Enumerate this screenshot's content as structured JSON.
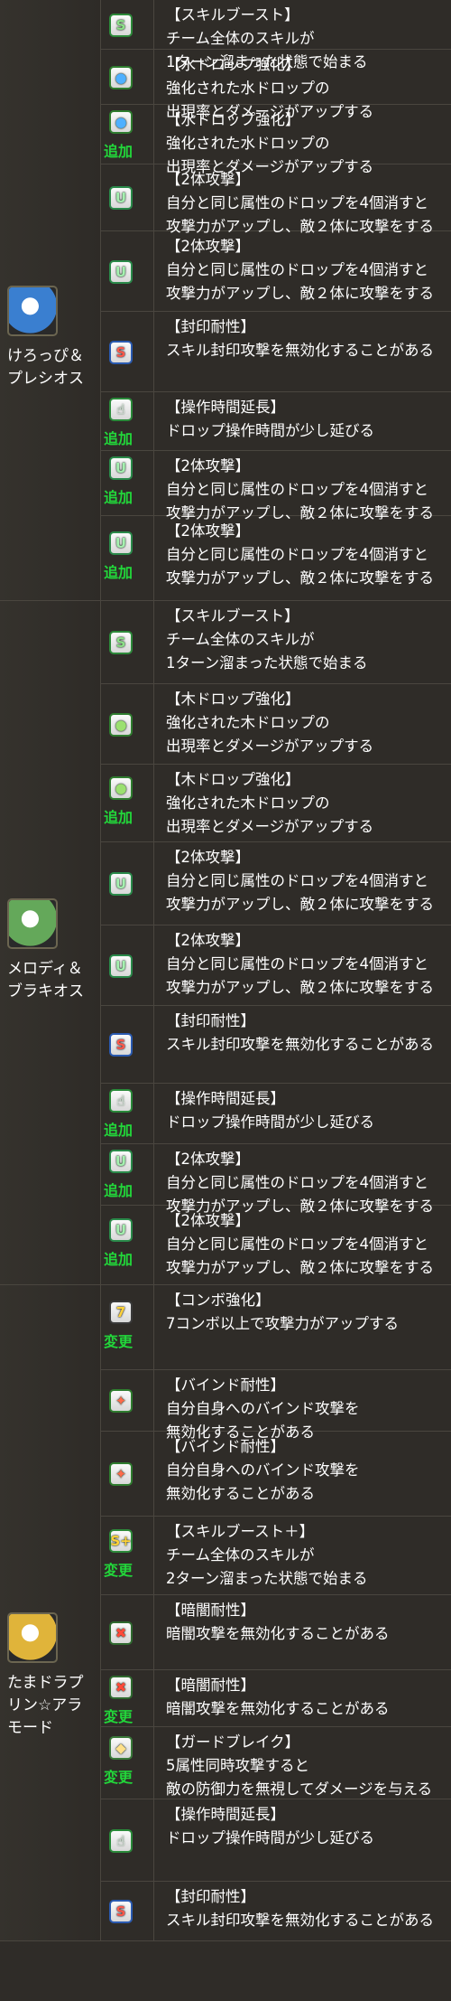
{
  "monsters": [
    {
      "name": "けろっぴ＆\nプレシオス",
      "icon": "keroppi-plesios-icon",
      "color": "#3a7fd0"
    },
    {
      "name": "メロディ＆\nブラキオス",
      "icon": "melody-brachios-icon",
      "color": "#64a85a"
    },
    {
      "name": "たまドラプ\nリン☆アラ\nモード",
      "icon": "tamadra-purin-icon",
      "color": "#e0b43a"
    }
  ],
  "tags": {
    "add": "追加",
    "change": "変更"
  },
  "awakenings": [
    {
      "title": "【スキルブースト】",
      "desc": "チーム全体のスキルが\n1ターン溜まった状態で始まる",
      "icon": "skill-boost-icon"
    },
    {
      "title": "【水ドロップ強化】",
      "desc": "強化された水ドロップの\n出現率とダメージがアップする",
      "icon": "water-drop-enhance-icon"
    },
    {
      "title": "【水ドロップ強化】",
      "desc": "強化された水ドロップの\n出現率とダメージがアップする",
      "icon": "water-drop-enhance-icon"
    },
    {
      "title": "【2体攻撃】",
      "desc": "自分と同じ属性のドロップを4個消すと\n攻撃力がアップし、敵２体に攻撃をする",
      "icon": "two-pronged-attack-icon"
    },
    {
      "title": "【2体攻撃】",
      "desc": "自分と同じ属性のドロップを4個消すと\n攻撃力がアップし、敵２体に攻撃をする",
      "icon": "two-pronged-attack-icon"
    },
    {
      "title": "【封印耐性】",
      "desc": "スキル封印攻撃を無効化することがある",
      "icon": "skill-bind-resist-icon"
    },
    {
      "title": "【操作時間延長】",
      "desc": "ドロップ操作時間が少し延びる",
      "icon": "time-extend-icon"
    },
    {
      "title": "【2体攻撃】",
      "desc": "自分と同じ属性のドロップを4個消すと\n攻撃力がアップし、敵２体に攻撃をする",
      "icon": "two-pronged-attack-icon"
    },
    {
      "title": "【2体攻撃】",
      "desc": "自分と同じ属性のドロップを4個消すと\n攻撃力がアップし、敵２体に攻撃をする",
      "icon": "two-pronged-attack-icon"
    },
    {
      "title": "【スキルブースト】",
      "desc": "チーム全体のスキルが\n1ターン溜まった状態で始まる",
      "icon": "skill-boost-icon"
    },
    {
      "title": "【木ドロップ強化】",
      "desc": "強化された木ドロップの\n出現率とダメージがアップする",
      "icon": "wood-drop-enhance-icon"
    },
    {
      "title": "【木ドロップ強化】",
      "desc": "強化された木ドロップの\n出現率とダメージがアップする",
      "icon": "wood-drop-enhance-icon"
    },
    {
      "title": "【2体攻撃】",
      "desc": "自分と同じ属性のドロップを4個消すと\n攻撃力がアップし、敵２体に攻撃をする",
      "icon": "two-pronged-attack-icon"
    },
    {
      "title": "【2体攻撃】",
      "desc": "自分と同じ属性のドロップを4個消すと\n攻撃力がアップし、敵２体に攻撃をする",
      "icon": "two-pronged-attack-icon"
    },
    {
      "title": "【封印耐性】",
      "desc": "スキル封印攻撃を無効化することがある",
      "icon": "skill-bind-resist-icon"
    },
    {
      "title": "【操作時間延長】",
      "desc": "ドロップ操作時間が少し延びる",
      "icon": "time-extend-icon"
    },
    {
      "title": "【2体攻撃】",
      "desc": "自分と同じ属性のドロップを4個消すと\n攻撃力がアップし、敵２体に攻撃をする",
      "icon": "two-pronged-attack-icon"
    },
    {
      "title": "【2体攻撃】",
      "desc": "自分と同じ属性のドロップを4個消すと\n攻撃力がアップし、敵２体に攻撃をする",
      "icon": "two-pronged-attack-icon"
    },
    {
      "title": "【コンボ強化】",
      "desc": "7コンボ以上で攻撃力がアップする",
      "icon": "combo-enhance-icon"
    },
    {
      "title": "【バインド耐性】",
      "desc": "自分自身へのバインド攻撃を\n無効化することがある",
      "icon": "bind-resist-icon"
    },
    {
      "title": "【バインド耐性】",
      "desc": "自分自身へのバインド攻撃を\n無効化することがある",
      "icon": "bind-resist-icon"
    },
    {
      "title": "【スキルブースト＋】",
      "desc": "チーム全体のスキルが\n2ターン溜まった状態で始まる",
      "icon": "skill-boost-plus-icon"
    },
    {
      "title": "【暗闇耐性】",
      "desc": "暗闇攻撃を無効化することがある",
      "icon": "blind-resist-icon"
    },
    {
      "title": "【暗闇耐性】",
      "desc": "暗闇攻撃を無効化することがある",
      "icon": "blind-resist-icon"
    },
    {
      "title": "【ガードブレイク】",
      "desc": "5属性同時攻撃すると\n敵の防御力を無視してダメージを与える",
      "icon": "guard-break-icon"
    },
    {
      "title": "【操作時間延長】",
      "desc": "ドロップ操作時間が少し延びる",
      "icon": "time-extend-icon"
    },
    {
      "title": "【封印耐性】",
      "desc": "スキル封印攻撃を無効化することがある",
      "icon": "skill-bind-resist-icon"
    }
  ]
}
